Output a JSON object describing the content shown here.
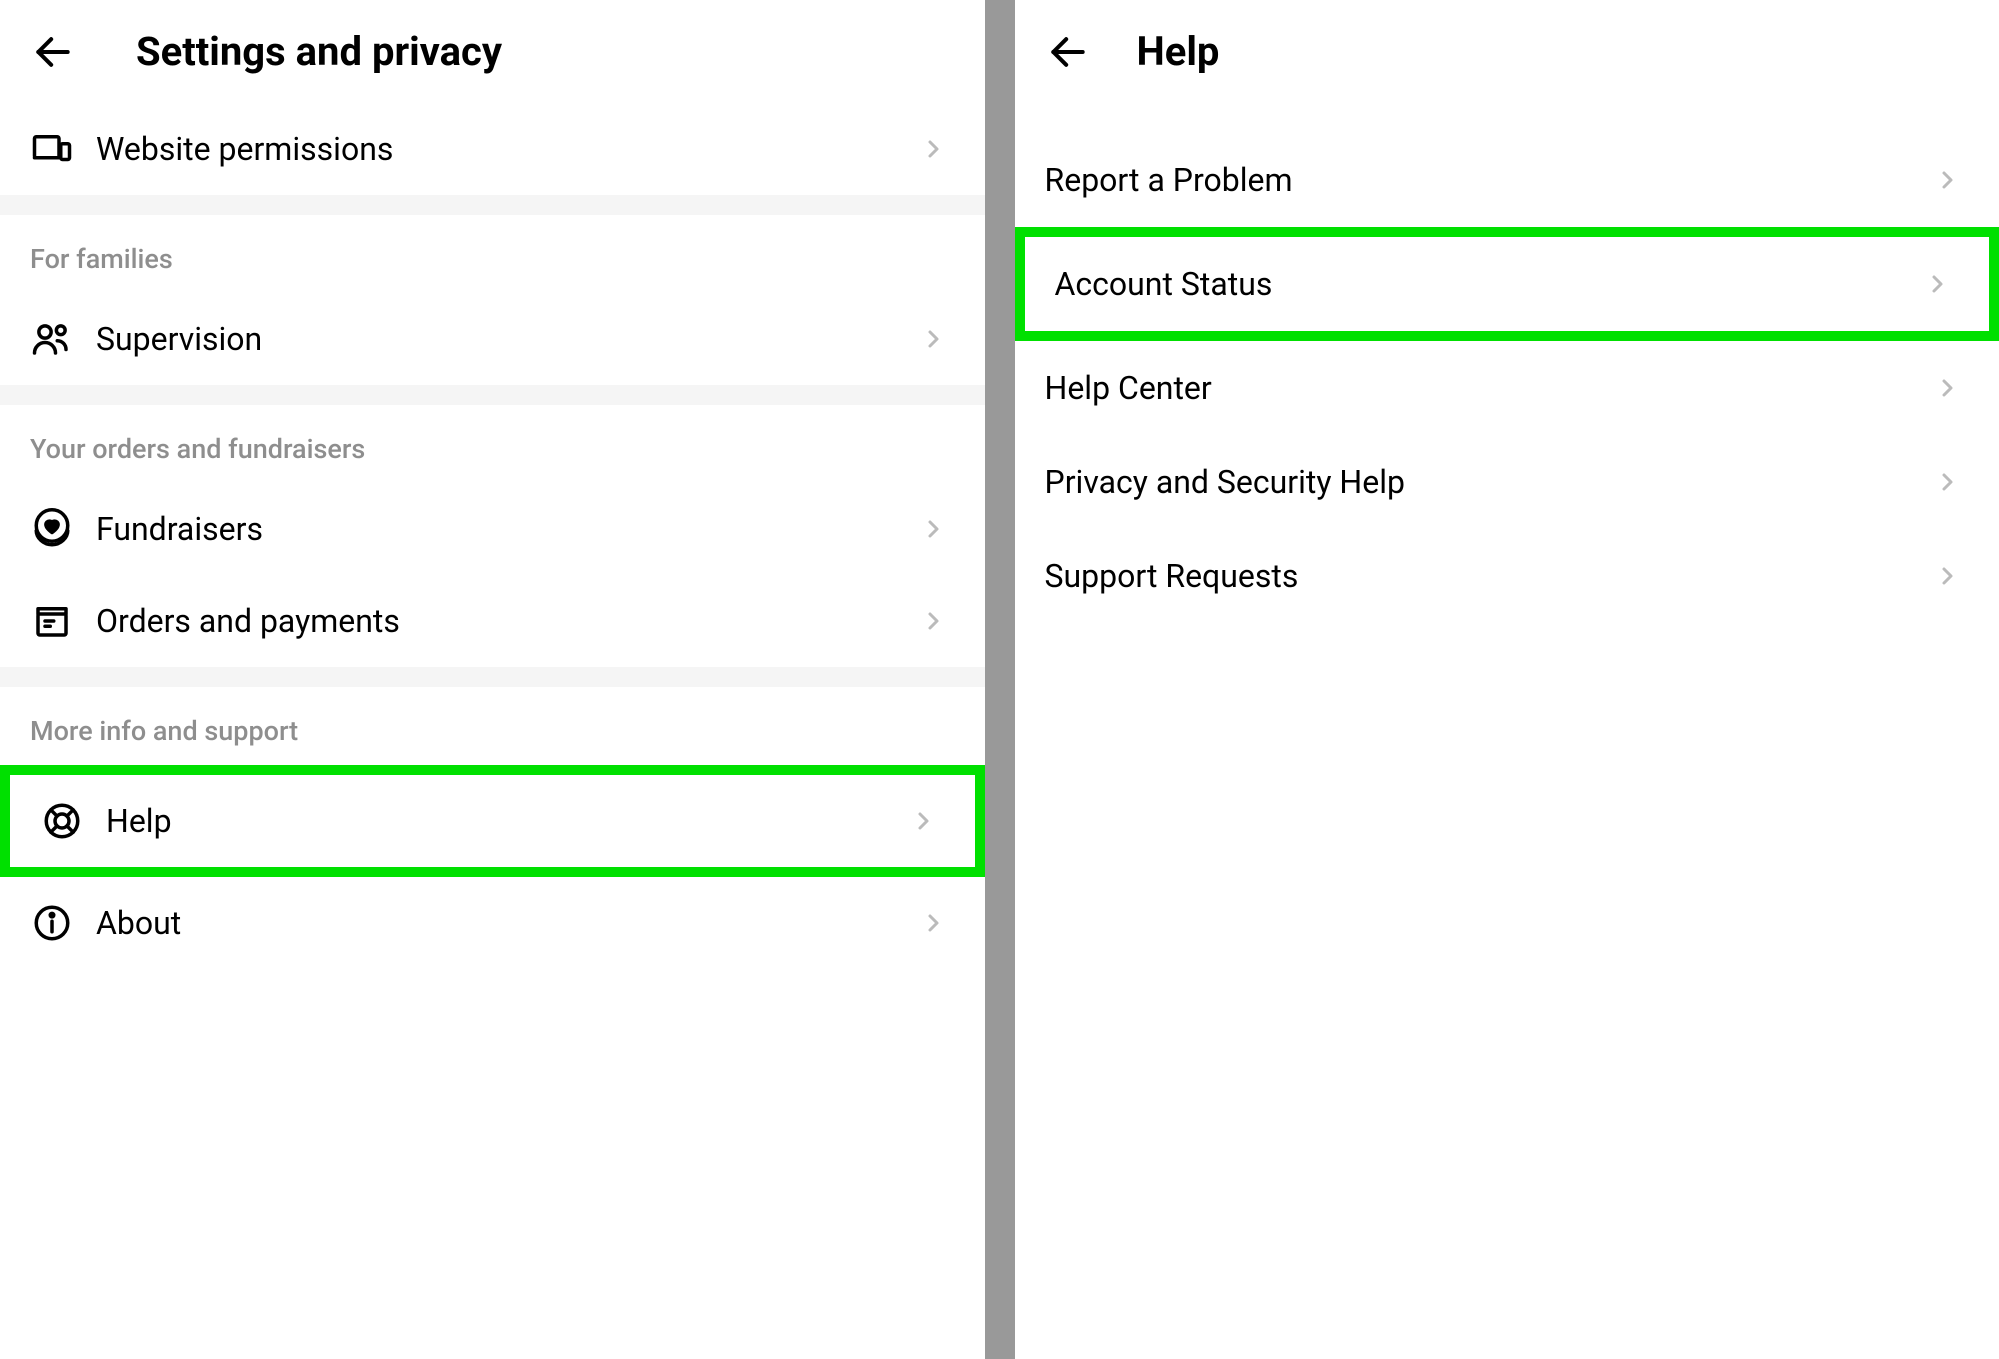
{
  "left": {
    "title": "Settings and privacy",
    "rows": {
      "website_permissions": "Website permissions",
      "supervision": "Supervision",
      "fundraisers": "Fundraisers",
      "orders_payments": "Orders and payments",
      "help": "Help",
      "about": "About"
    },
    "sections": {
      "for_families": "For families",
      "orders_fundraisers": "Your orders and fundraisers",
      "more_info": "More info and support"
    }
  },
  "right": {
    "title": "Help",
    "rows": {
      "report_problem": "Report a Problem",
      "account_status": "Account Status",
      "help_center": "Help Center",
      "privacy_security": "Privacy and Security Help",
      "support_requests": "Support Requests"
    }
  }
}
